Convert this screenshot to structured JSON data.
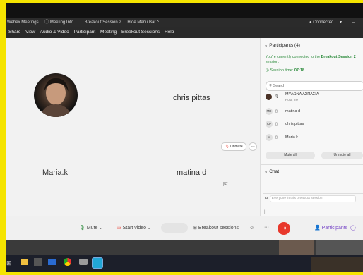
{
  "app_bar": {
    "webex_meetings": "Webex Meetings",
    "meeting_info": "Meeting Info",
    "breakout_session": "Breakout Session 2",
    "hide_menu_bar": "Hide Menu Bar ^",
    "connected": "Connected"
  },
  "menu": [
    "Share",
    "View",
    "Audio & Video",
    "Participant",
    "Meeting",
    "Breakout Sessions",
    "Help"
  ],
  "stage": {
    "names": [
      "chris pittas",
      "Maria.k",
      "matina d"
    ],
    "unmute_label": "Unmute"
  },
  "participants_panel": {
    "title": "Participants (4)",
    "connected_prefix": "You're currently connected to the",
    "connected_session": "Breakout Session 2",
    "connected_suffix": "session.",
    "session_time_label": "Session time:",
    "session_time": "07:18",
    "search_placeholder": "Search",
    "list": [
      {
        "initials": "",
        "name": "ΜΥΛΩΝΑ ΑΣΠΑΣΙΑ",
        "role": "Host, me"
      },
      {
        "initials": "MD",
        "name": "matina d",
        "role": ""
      },
      {
        "initials": "CP",
        "name": "chris pittas",
        "role": ""
      },
      {
        "initials": "M",
        "name": "Maria.k",
        "role": ""
      }
    ],
    "mute_all": "Mute all",
    "unmute_all": "Unmute all"
  },
  "chat": {
    "title": "Chat",
    "to_label": "To:",
    "to_value": "Everyone in this breakout session"
  },
  "controls": {
    "mute": "Mute",
    "start_video": "Start video",
    "breakout_sessions": "Breakout sessions",
    "participants": "Participants"
  },
  "colors": {
    "accent_green": "#2a8a3a",
    "leave_red": "#e8382c",
    "frame_yellow": "#f5e400"
  }
}
